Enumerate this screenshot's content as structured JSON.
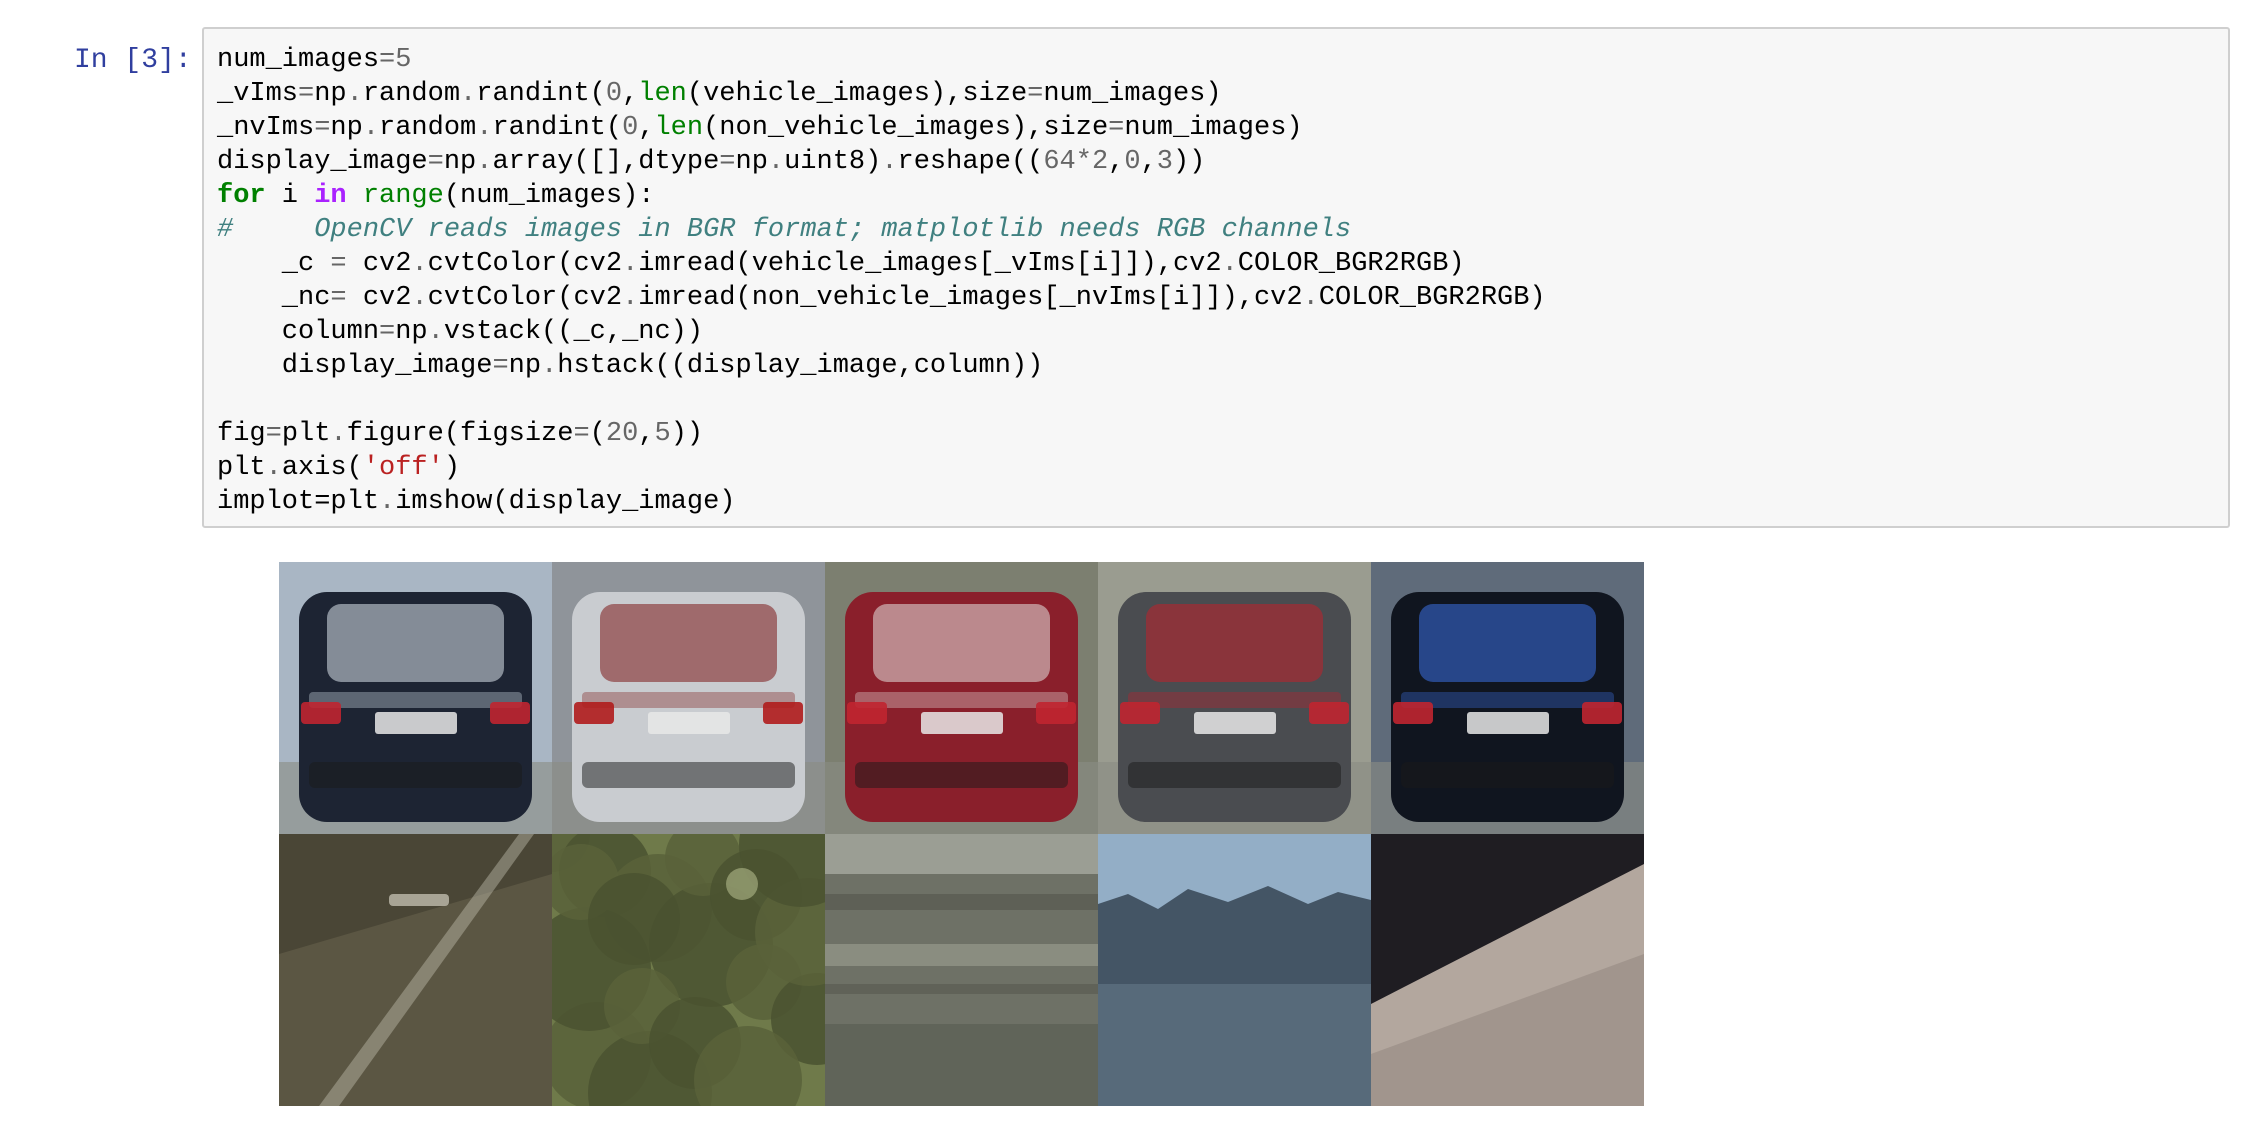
{
  "cell": {
    "prompt": "In [3]:",
    "code_lines": [
      [
        {
          "t": "num_images"
        },
        {
          "t": "=",
          "c": "op"
        },
        {
          "t": "5",
          "c": "num"
        }
      ],
      [
        {
          "t": "_vIms"
        },
        {
          "t": "=",
          "c": "op"
        },
        {
          "t": "np"
        },
        {
          "t": ".",
          "c": "op"
        },
        {
          "t": "random"
        },
        {
          "t": ".",
          "c": "op"
        },
        {
          "t": "randint("
        },
        {
          "t": "0",
          "c": "num"
        },
        {
          "t": ","
        },
        {
          "t": "len",
          "c": "builtin"
        },
        {
          "t": "(vehicle_images),size"
        },
        {
          "t": "=",
          "c": "op"
        },
        {
          "t": "num_images)"
        }
      ],
      [
        {
          "t": "_nvIms"
        },
        {
          "t": "=",
          "c": "op"
        },
        {
          "t": "np"
        },
        {
          "t": ".",
          "c": "op"
        },
        {
          "t": "random"
        },
        {
          "t": ".",
          "c": "op"
        },
        {
          "t": "randint("
        },
        {
          "t": "0",
          "c": "num"
        },
        {
          "t": ","
        },
        {
          "t": "len",
          "c": "builtin"
        },
        {
          "t": "(non_vehicle_images),size"
        },
        {
          "t": "=",
          "c": "op"
        },
        {
          "t": "num_images)"
        }
      ],
      [
        {
          "t": "display_image"
        },
        {
          "t": "=",
          "c": "op"
        },
        {
          "t": "np"
        },
        {
          "t": ".",
          "c": "op"
        },
        {
          "t": "array([],dtype"
        },
        {
          "t": "=",
          "c": "op"
        },
        {
          "t": "np"
        },
        {
          "t": ".",
          "c": "op"
        },
        {
          "t": "uint8)"
        },
        {
          "t": ".",
          "c": "op"
        },
        {
          "t": "reshape(("
        },
        {
          "t": "64",
          "c": "num"
        },
        {
          "t": "*",
          "c": "op"
        },
        {
          "t": "2",
          "c": "num"
        },
        {
          "t": ","
        },
        {
          "t": "0",
          "c": "num"
        },
        {
          "t": ","
        },
        {
          "t": "3",
          "c": "num"
        },
        {
          "t": "))"
        }
      ],
      [
        {
          "t": "for",
          "c": "kw"
        },
        {
          "t": " i "
        },
        {
          "t": "in",
          "c": "opw"
        },
        {
          "t": " "
        },
        {
          "t": "range",
          "c": "builtin"
        },
        {
          "t": "(num_images):"
        }
      ],
      [
        {
          "t": "#     OpenCV reads images in BGR format; matplotlib needs RGB channels",
          "c": "comment"
        }
      ],
      [
        {
          "t": "    _c "
        },
        {
          "t": "=",
          "c": "op"
        },
        {
          "t": " cv2"
        },
        {
          "t": ".",
          "c": "op"
        },
        {
          "t": "cvtColor(cv2"
        },
        {
          "t": ".",
          "c": "op"
        },
        {
          "t": "imread(vehicle_images[_vIms[i]]),cv2"
        },
        {
          "t": ".",
          "c": "op"
        },
        {
          "t": "COLOR_BGR2RGB)"
        }
      ],
      [
        {
          "t": "    _nc"
        },
        {
          "t": "=",
          "c": "op"
        },
        {
          "t": " cv2"
        },
        {
          "t": ".",
          "c": "op"
        },
        {
          "t": "cvtColor(cv2"
        },
        {
          "t": ".",
          "c": "op"
        },
        {
          "t": "imread(non_vehicle_images[_nvIms[i]]),cv2"
        },
        {
          "t": ".",
          "c": "op"
        },
        {
          "t": "COLOR_BGR2RGB)"
        }
      ],
      [
        {
          "t": "    column"
        },
        {
          "t": "=",
          "c": "op"
        },
        {
          "t": "np"
        },
        {
          "t": ".",
          "c": "op"
        },
        {
          "t": "vstack((_c,_nc))"
        }
      ],
      [
        {
          "t": "    display_image"
        },
        {
          "t": "=",
          "c": "op"
        },
        {
          "t": "np"
        },
        {
          "t": ".",
          "c": "op"
        },
        {
          "t": "hstack((display_image,column))"
        }
      ],
      [],
      [
        {
          "t": "fig"
        },
        {
          "t": "=",
          "c": "op"
        },
        {
          "t": "plt"
        },
        {
          "t": ".",
          "c": "op"
        },
        {
          "t": "figure(figsize"
        },
        {
          "t": "=",
          "c": "op"
        },
        {
          "t": "("
        },
        {
          "t": "20",
          "c": "num"
        },
        {
          "t": ","
        },
        {
          "t": "5",
          "c": "num"
        },
        {
          "t": "))"
        }
      ],
      [
        {
          "t": "plt"
        },
        {
          "t": ".",
          "c": "op"
        },
        {
          "t": "axis("
        },
        {
          "t": "'off'",
          "c": "str"
        },
        {
          "t": ")"
        }
      ],
      [
        {
          "t": "implot"
        },
        {
          "t": "="
        },
        {
          "t": "plt"
        },
        {
          "t": ".",
          "c": "op"
        },
        {
          "t": "imshow(display_image)"
        }
      ]
    ]
  },
  "output": {
    "tiles": [
      {
        "name": "vehicle-tile-1",
        "kind": "vehicle",
        "bg": "#a9b6c4",
        "body": "#1d2433",
        "accent": "#d8e2ea"
      },
      {
        "name": "vehicle-tile-2",
        "kind": "vehicle",
        "bg": "#8f949a",
        "body": "#c9ccd0",
        "accent": "#7b1a1a"
      },
      {
        "name": "vehicle-tile-3",
        "kind": "vehicle",
        "bg": "#7c7f70",
        "body": "#8a1f2b",
        "accent": "#e4e0de"
      },
      {
        "name": "vehicle-tile-4",
        "kind": "vehicle",
        "bg": "#9a9c90",
        "body": "#4a4c50",
        "accent": "#c0202a"
      },
      {
        "name": "vehicle-tile-5",
        "kind": "vehicle",
        "bg": "#5f6b7a",
        "body": "#10151f",
        "accent": "#3b6fe0"
      },
      {
        "name": "non-vehicle-tile-1",
        "kind": "road",
        "bg": "#4a4636",
        "body": "#6b664f",
        "accent": "#bfbcae"
      },
      {
        "name": "non-vehicle-tile-2",
        "kind": "trees",
        "bg": "#6f7a4a",
        "body": "#4a5230",
        "accent": "#a3ab7d"
      },
      {
        "name": "non-vehicle-tile-3",
        "kind": "rail",
        "bg": "#6e7166",
        "body": "#8d9083",
        "accent": "#5a5c52"
      },
      {
        "name": "non-vehicle-tile-4",
        "kind": "forest",
        "bg": "#93aec6",
        "body": "#3f5060",
        "accent": "#6a7f90"
      },
      {
        "name": "non-vehicle-tile-5",
        "kind": "wall",
        "bg": "#1f1d22",
        "body": "#b3a79e",
        "accent": "#8f837b"
      }
    ]
  }
}
